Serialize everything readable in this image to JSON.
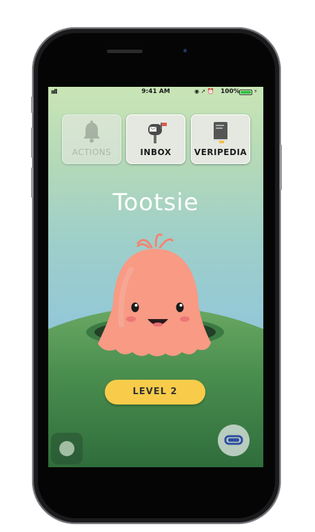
{
  "status_bar": {
    "signal": "ııll",
    "time": "9:41 AM",
    "icons": "◉ ➚ ⏰",
    "battery_text": "100%",
    "battery_level": 1.0
  },
  "tiles": [
    {
      "label": "ACTIONS",
      "icon": "bell-icon",
      "enabled": false
    },
    {
      "label": "INBOX",
      "icon": "mailbox-icon",
      "enabled": true
    },
    {
      "label": "VERIPEDIA",
      "icon": "book-icon",
      "enabled": true
    }
  ],
  "pet": {
    "name": "Tootsie",
    "color": "#f89a84"
  },
  "level_button": {
    "label": "LEVEL 2",
    "color": "#f8cc4a"
  },
  "floating_buttons": {
    "left": "joystick-icon",
    "right": "goggles-icon"
  }
}
